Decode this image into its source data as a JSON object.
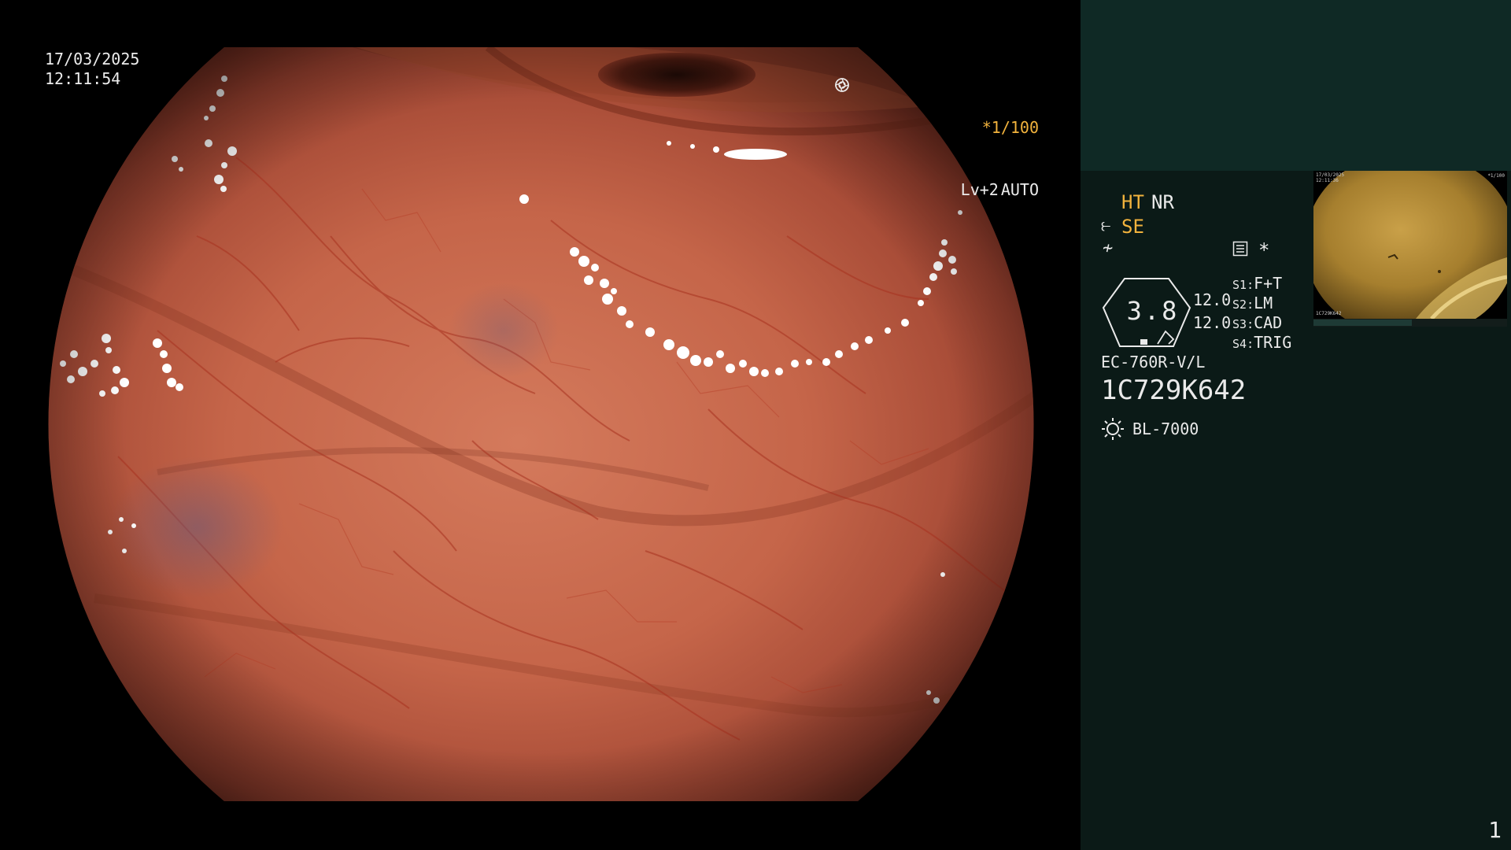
{
  "overlay": {
    "date": "17/03/2025",
    "time": "12:11:54",
    "shutter": "*1/100",
    "shutter_icon": "aperture-icon",
    "iris_level": "Lv+2",
    "iris_mode": "AUTO",
    "iris_icon": "target-icon"
  },
  "panel": {
    "mode_ht": "HT",
    "mode_nr": "NR",
    "mode_se": "SE",
    "zoom_value": "3.8",
    "iris_values": [
      "12.0",
      "12.0"
    ],
    "switches": [
      {
        "key": "S1",
        "func": "F+T"
      },
      {
        "key": "S2",
        "func": "LM"
      },
      {
        "key": "S3",
        "func": "CAD"
      },
      {
        "key": "S4",
        "func": "TRIG"
      }
    ],
    "scope_model": "EC-760R-V/L",
    "scope_serial": "1C729K642",
    "light_source": "BL-7000",
    "page_number": "1",
    "asterisk": "*"
  },
  "pip": {
    "date": "17/03/2025",
    "time": "12:11:36",
    "settings": "*1/100",
    "serial": "1C729K642"
  },
  "colors": {
    "accent_amber": "#f2b33d",
    "panel_bg": "#0b1a17",
    "panel_top_bg": "#0f2925"
  }
}
